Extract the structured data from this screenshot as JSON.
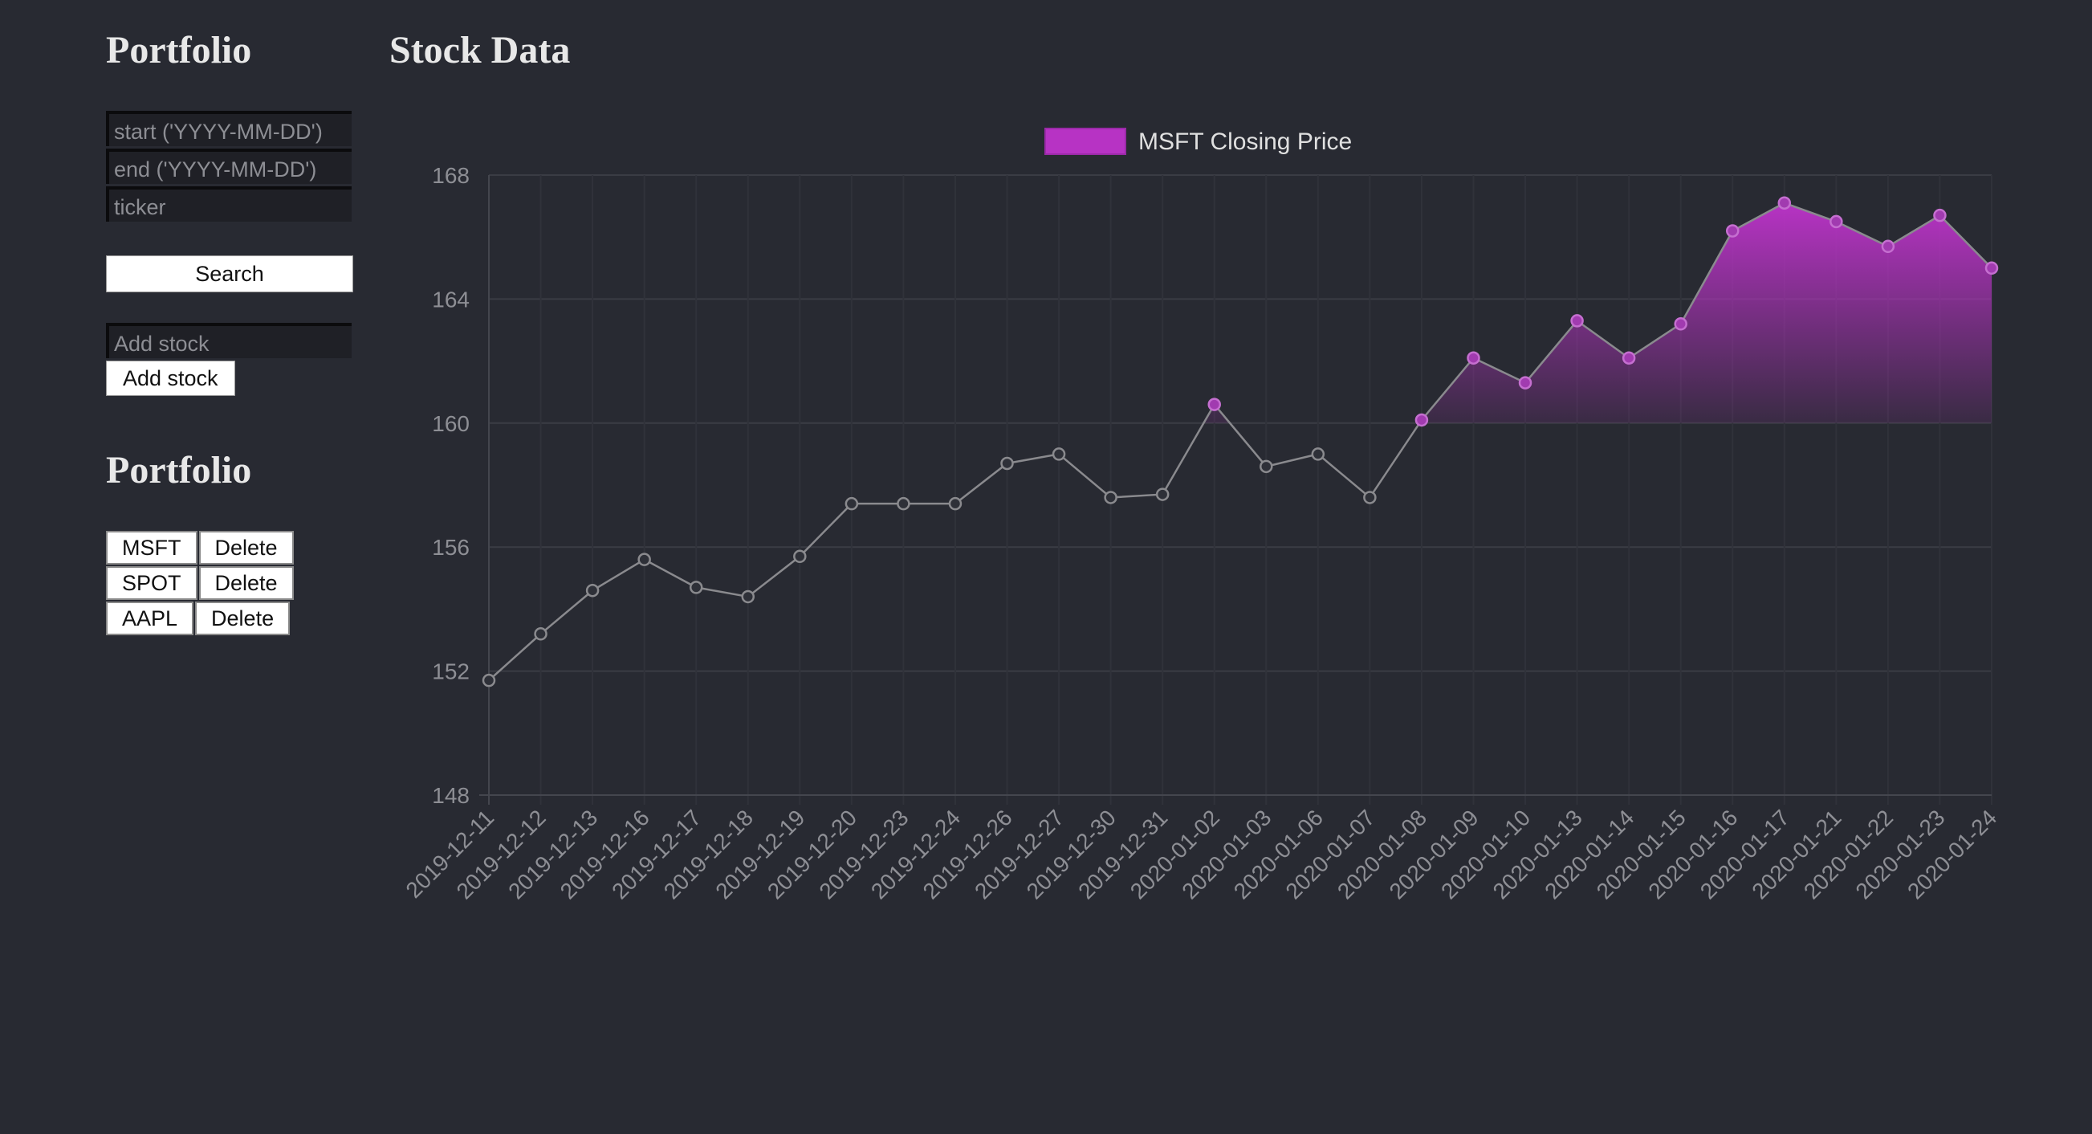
{
  "sidebar": {
    "title": "Portfolio",
    "start_placeholder": "start ('YYYY-MM-DD')",
    "end_placeholder": "end ('YYYY-MM-DD')",
    "ticker_placeholder": "ticker",
    "search_label": "Search",
    "add_placeholder": "Add stock",
    "add_label": "Add stock",
    "portfolio_title": "Portfolio",
    "stocks": [
      {
        "ticker": "MSFT",
        "delete_label": "Delete"
      },
      {
        "ticker": "SPOT",
        "delete_label": "Delete"
      },
      {
        "ticker": "AAPL",
        "delete_label": "Delete"
      }
    ]
  },
  "main": {
    "title": "Stock Data"
  },
  "colors": {
    "background": "#282a32",
    "accent": "#b733c4",
    "line": "#8a8a8e",
    "grid": "#3a3c44",
    "tick_text": "#8e8f95",
    "legend_text": "#e0e0e0"
  },
  "chart_data": {
    "type": "line",
    "legend": "MSFT Closing Price",
    "legend_position": "top",
    "grid": true,
    "ylim": [
      148,
      168
    ],
    "yticks": [
      148,
      152,
      156,
      160,
      164,
      168
    ],
    "fill_baseline": 160,
    "x": [
      "2019-12-11",
      "2019-12-12",
      "2019-12-13",
      "2019-12-16",
      "2019-12-17",
      "2019-12-18",
      "2019-12-19",
      "2019-12-20",
      "2019-12-23",
      "2019-12-24",
      "2019-12-26",
      "2019-12-27",
      "2019-12-30",
      "2019-12-31",
      "2020-01-02",
      "2020-01-03",
      "2020-01-06",
      "2020-01-07",
      "2020-01-08",
      "2020-01-09",
      "2020-01-10",
      "2020-01-13",
      "2020-01-14",
      "2020-01-15",
      "2020-01-16",
      "2020-01-17",
      "2020-01-21",
      "2020-01-22",
      "2020-01-23",
      "2020-01-24"
    ],
    "values": [
      151.7,
      153.2,
      154.6,
      155.6,
      154.7,
      154.4,
      155.7,
      157.4,
      157.4,
      157.4,
      158.7,
      159.0,
      157.6,
      157.7,
      160.6,
      158.6,
      159.0,
      157.6,
      160.1,
      162.1,
      161.3,
      163.3,
      162.1,
      163.2,
      166.2,
      167.1,
      166.5,
      165.7,
      166.7,
      165.0
    ]
  }
}
